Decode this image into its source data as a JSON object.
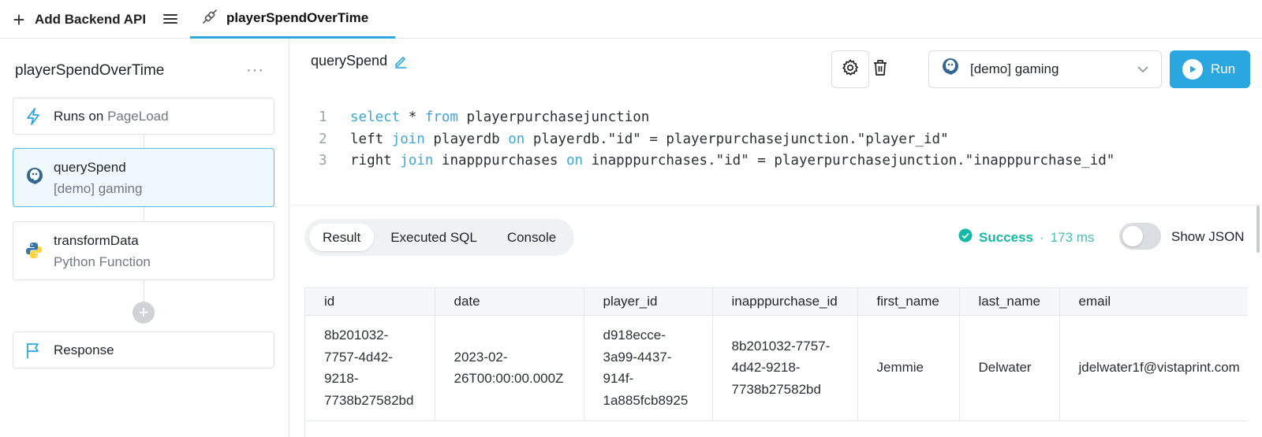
{
  "topbar": {
    "add_api_label": "Add Backend API",
    "active_tab_label": "playerSpendOverTime"
  },
  "sidebar": {
    "title": "playerSpendOverTime",
    "more_label": "···",
    "trigger": {
      "runs_on_label": "Runs on",
      "runs_on_value": "PageLoad"
    },
    "steps": [
      {
        "title": "querySpend",
        "subtitle": "[demo] gaming",
        "icon": "postgres-icon"
      },
      {
        "title": "transformData",
        "subtitle": "Python Function",
        "icon": "python-icon"
      }
    ],
    "add_step_label": "+",
    "response_label": "Response"
  },
  "editor": {
    "query_name": "querySpend",
    "resource": "[demo] gaming",
    "run_label": "Run",
    "code_lines": [
      {
        "n": "1",
        "parts": [
          {
            "t": "select",
            "k": 1
          },
          {
            "t": " * ",
            "k": 0
          },
          {
            "t": "from",
            "k": 1
          },
          {
            "t": " playerpurchasejunction",
            "k": 0
          }
        ]
      },
      {
        "n": "2",
        "parts": [
          {
            "t": "left ",
            "k": 0
          },
          {
            "t": "join",
            "k": 1
          },
          {
            "t": " playerdb ",
            "k": 0
          },
          {
            "t": "on",
            "k": 1
          },
          {
            "t": " playerdb.\"id\" = playerpurchasejunction.\"player_id\"",
            "k": 0
          }
        ]
      },
      {
        "n": "3",
        "parts": [
          {
            "t": "right ",
            "k": 0
          },
          {
            "t": "join",
            "k": 1
          },
          {
            "t": " inapppurchases ",
            "k": 0
          },
          {
            "t": "on",
            "k": 1
          },
          {
            "t": " inapppurchases.\"id\" = playerpurchasejunction.\"inapppurchase_id\"",
            "k": 0
          }
        ]
      }
    ]
  },
  "results": {
    "tabs": [
      "Result",
      "Executed SQL",
      "Console"
    ],
    "active_tab": "Result",
    "status_label": "Success",
    "separator": "·",
    "duration": "173 ms",
    "show_json_label": "Show JSON",
    "show_json_on": false,
    "columns": [
      "id",
      "date",
      "player_id",
      "inapppurchase_id",
      "first_name",
      "last_name",
      "email"
    ],
    "rows": [
      [
        "8b201032-\n7757-4d42-\n9218-\n7738b27582bd",
        "2023-02-\n26T00:00:00.000Z",
        "d918ecce-\n3a99-4437-\n914f-\n1a885fcb8925",
        "8b201032-7757-\n4d42-9218-\n7738b27582bd",
        "Jemmie",
        "Delwater",
        "jdelwater1f@vistaprint.com"
      ]
    ]
  },
  "colors": {
    "accent": "#2aa7df",
    "keyword": "#3fa6d8",
    "success": "#14b8a6",
    "selected_bg": "#eef8fd"
  }
}
